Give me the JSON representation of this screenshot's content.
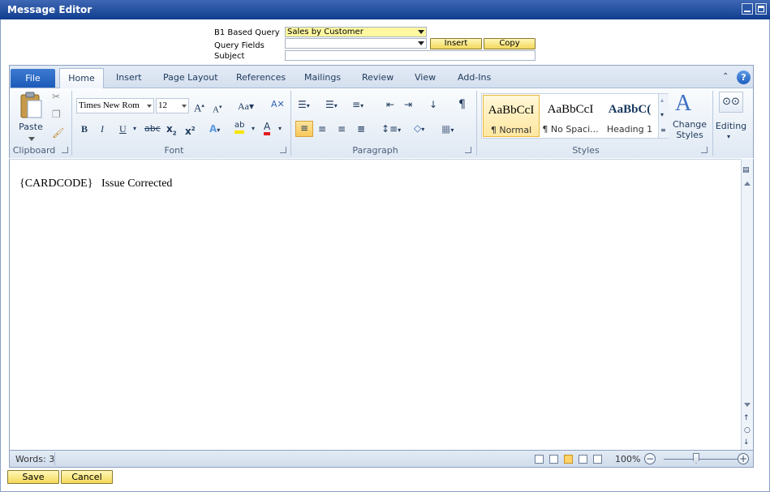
{
  "window": {
    "title": "Message Editor"
  },
  "query_form": {
    "b1_based_query_label": "B1 Based Query",
    "b1_based_query_value": "Sales by Customer",
    "query_fields_label": "Query Fields",
    "query_fields_value": "",
    "subject_label": "Subject",
    "subject_value": "",
    "insert_label": "Insert",
    "copy_label": "Copy"
  },
  "ribbon": {
    "tabs": [
      "File",
      "Home",
      "Insert",
      "Page Layout",
      "References",
      "Mailings",
      "Review",
      "View",
      "Add-Ins"
    ],
    "clipboard": {
      "label": "Clipboard",
      "paste_label": "Paste"
    },
    "font": {
      "label": "Font",
      "family": "Times New Rom",
      "size": "12"
    },
    "paragraph": {
      "label": "Paragraph"
    },
    "styles": {
      "label": "Styles",
      "items": [
        {
          "sample": "AaBbCcI",
          "name": "¶ Normal"
        },
        {
          "sample": "AaBbCcI",
          "name": "¶ No Spaci..."
        },
        {
          "sample": "AaBbC(",
          "name": "Heading 1"
        }
      ],
      "change_styles_label": "Change Styles"
    },
    "editing": {
      "label": "Editing"
    }
  },
  "document": {
    "text": "{CARDCODE}   Issue Corrected"
  },
  "statusbar": {
    "words": "Words: 3",
    "zoom": "100%"
  },
  "footer": {
    "save_label": "Save",
    "cancel_label": "Cancel"
  },
  "colors": {
    "title_bar": "#0f3d8f",
    "accent_yellow": "#f3d85a",
    "file_tab": "#1c5bb8"
  }
}
